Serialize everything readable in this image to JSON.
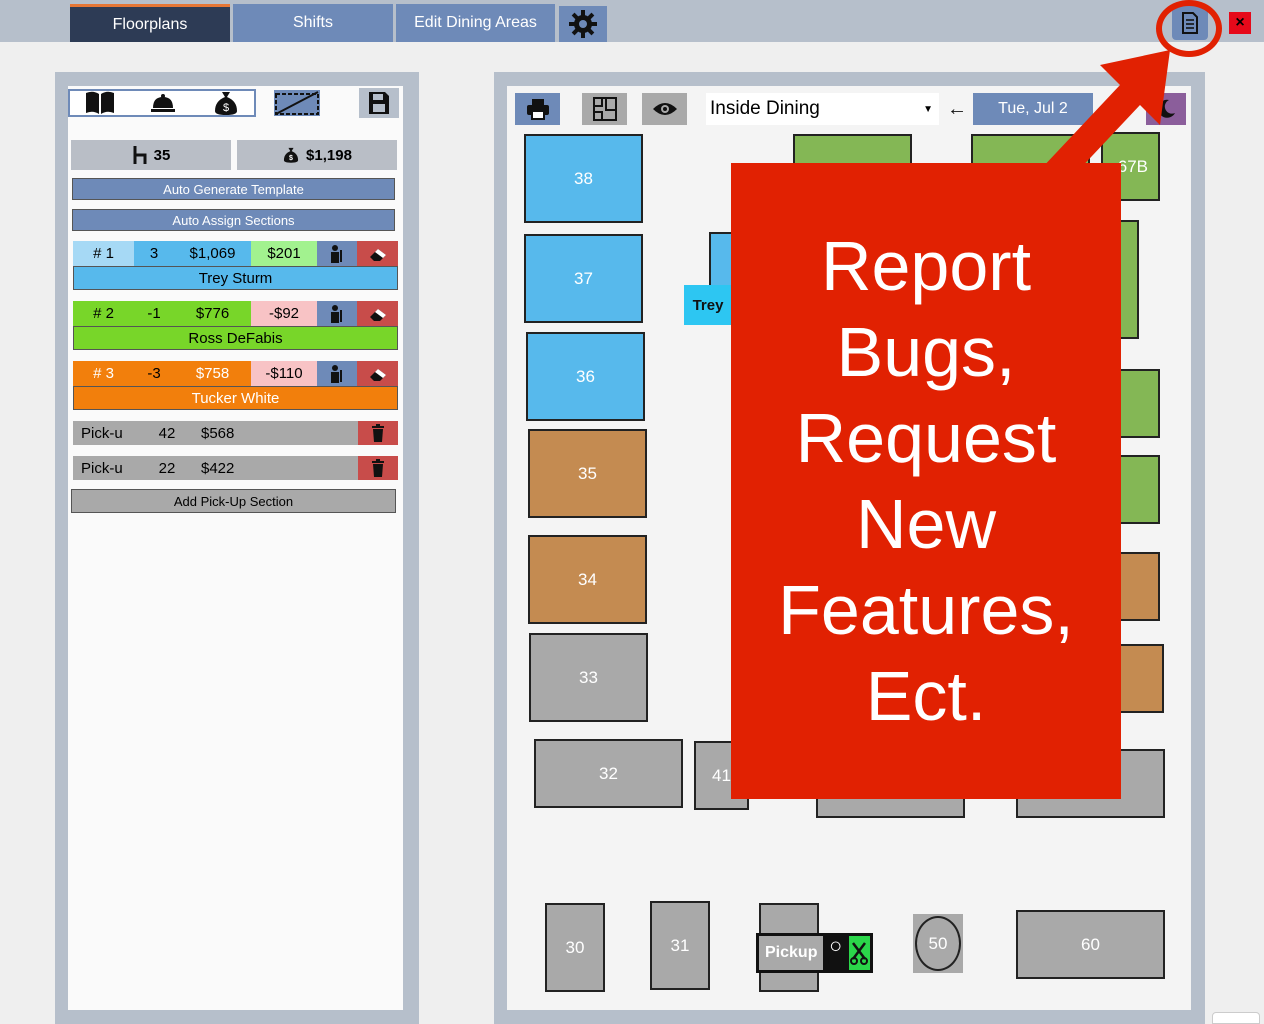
{
  "nav": {
    "tabs": [
      {
        "label": "Floorplans"
      },
      {
        "label": "Shifts"
      },
      {
        "label": "Edit Dining Areas"
      }
    ],
    "settings_icon": "gear-icon",
    "report_icon": "document-icon",
    "close_label": "×"
  },
  "sidebar": {
    "icons": [
      "book-icon",
      "cloche-icon",
      "money-bag-icon",
      "stairs-icon",
      "save-icon"
    ],
    "covers": "35",
    "sales": "$1,198",
    "auto_generate_label": "Auto Generate Template",
    "auto_assign_label": "Auto Assign Sections",
    "sections": [
      {
        "number": "# 1",
        "count": "3",
        "sales": "$1,069",
        "diff": "$201",
        "server": "Trey Sturm"
      },
      {
        "number": "# 2",
        "count": "-1",
        "sales": "$776",
        "diff": "-$92",
        "server": "Ross DeFabis"
      },
      {
        "number": "# 3",
        "count": "-3",
        "sales": "$758",
        "diff": "-$110",
        "server": "Tucker White"
      }
    ],
    "pickups": [
      {
        "label": "Pick-u",
        "count": "42",
        "sales": "$568"
      },
      {
        "label": "Pick-u",
        "count": "22",
        "sales": "$422"
      }
    ],
    "add_pickup_label": "Add Pick-Up Section"
  },
  "floor": {
    "area_select": "Inside Dining",
    "date": "Tue, Jul 2",
    "server_tag": "Trey",
    "pickup_tag": "Pickup",
    "tables": {
      "t38": "38",
      "t37": "37",
      "t36": "36",
      "t35": "35",
      "t34": "34",
      "t33": "33",
      "t32": "32",
      "t41": "41",
      "t67b": "67B",
      "t30": "30",
      "t31": "31",
      "t50": "50",
      "t60": "60"
    }
  },
  "annotation": {
    "text_lines": [
      "Report",
      "Bugs,",
      "Request",
      "New",
      "Features,",
      "Ect."
    ]
  },
  "colors": {
    "nav_active": "#2d3b55",
    "nav_tab": "#6e8ab8",
    "section_1": "#57b9ec",
    "section_2": "#78d629",
    "section_3": "#f27f0c",
    "callout_red": "#e12102"
  }
}
